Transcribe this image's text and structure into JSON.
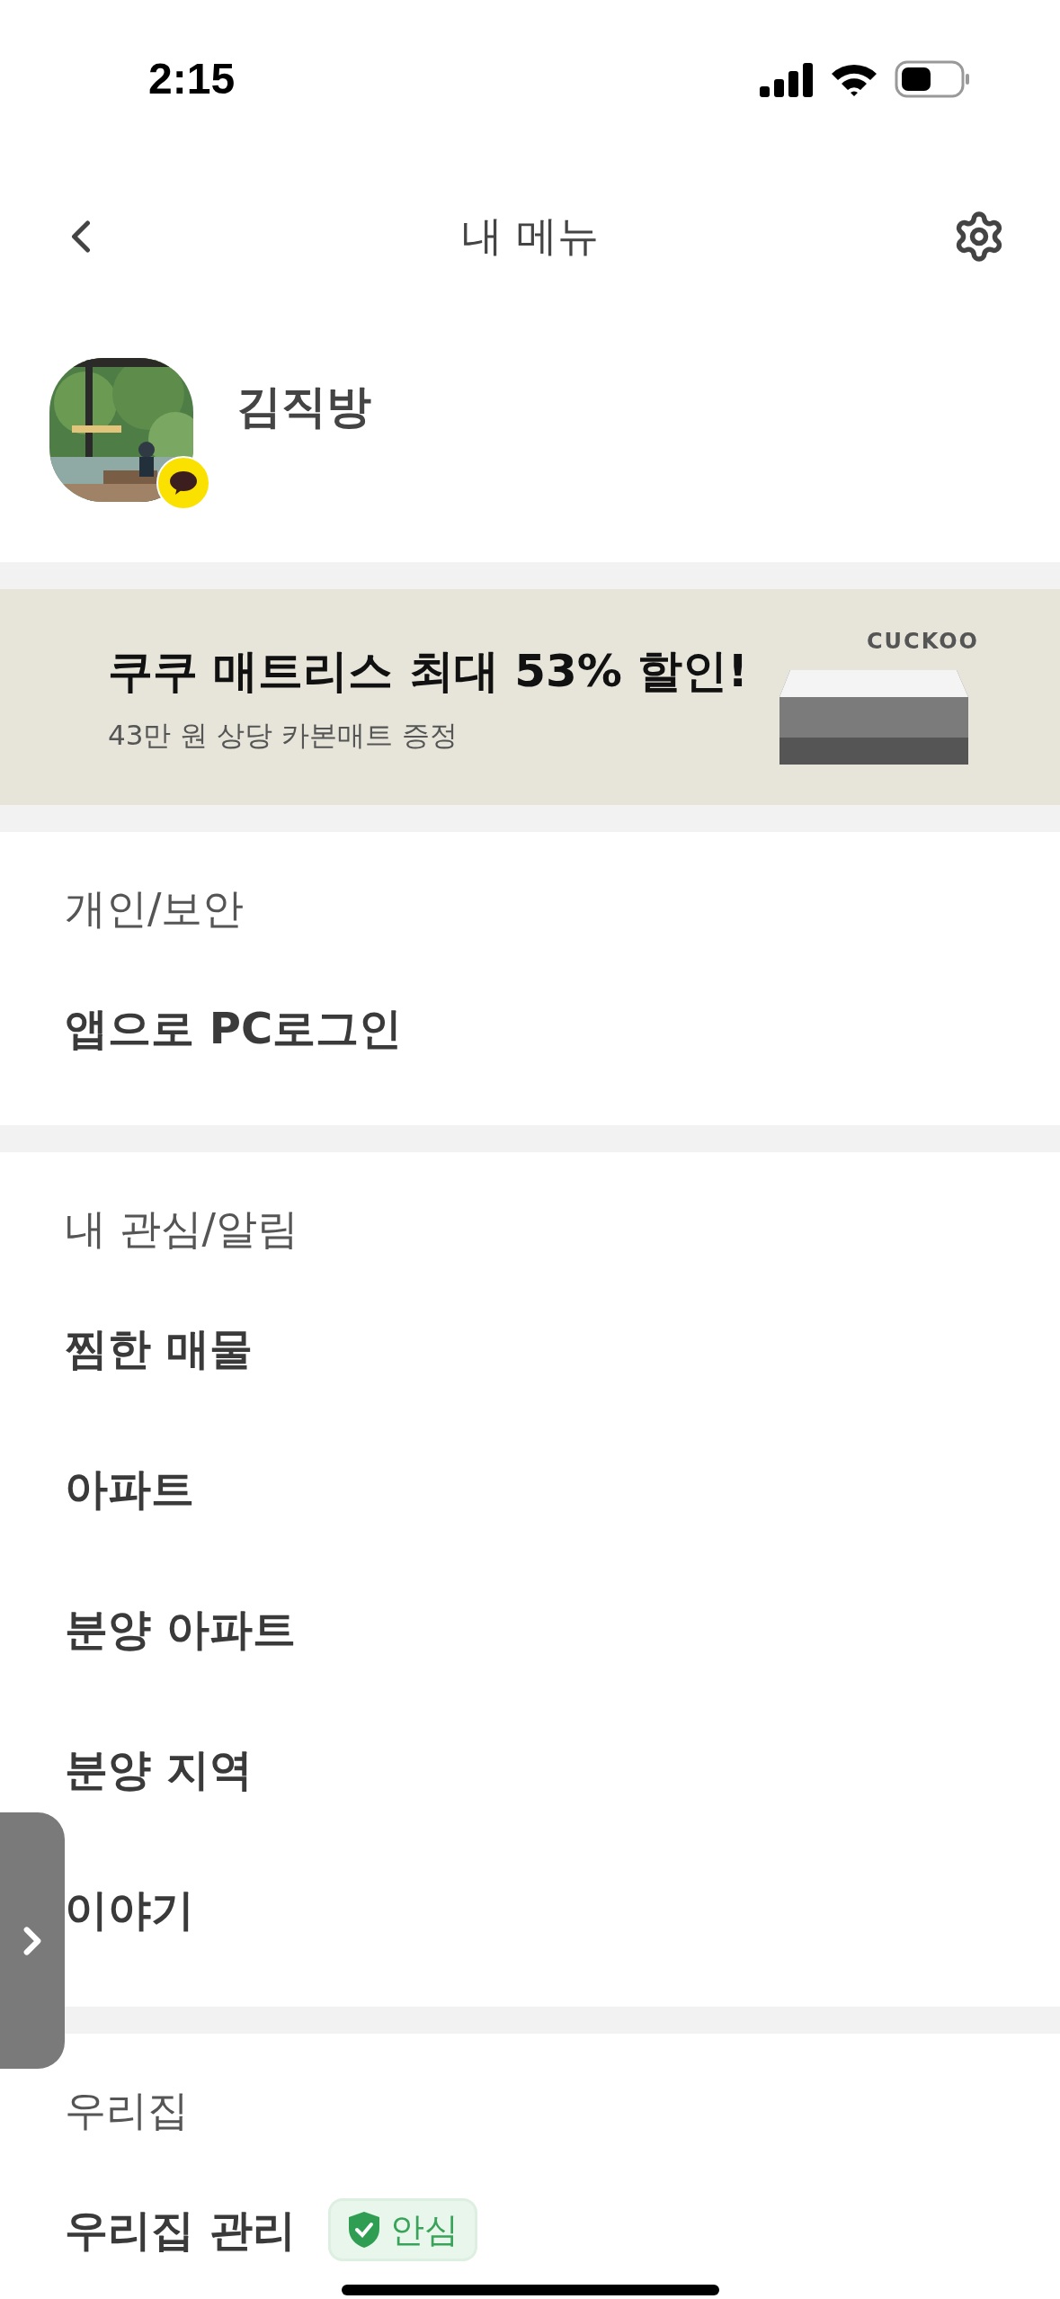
{
  "status_bar": {
    "time": "2:15"
  },
  "header": {
    "title": "내 메뉴"
  },
  "profile": {
    "name": "김직방"
  },
  "banner": {
    "brand": "CUCKOO",
    "headline": "쿠쿠 매트리스 최대 53% 할인!",
    "subtext": "43만 원 상당 카본매트 증정"
  },
  "sections": [
    {
      "title": "개인/보안",
      "items": [
        {
          "label": "앱으로 PC로그인"
        }
      ]
    },
    {
      "title": "내 관심/알림",
      "items": [
        {
          "label": "찜한 매물"
        },
        {
          "label": "아파트"
        },
        {
          "label": "분양 아파트"
        },
        {
          "label": "분양 지역"
        },
        {
          "label": "이야기"
        }
      ]
    },
    {
      "title": "우리집",
      "items": [
        {
          "label": "우리집 관리",
          "badge": "안심"
        }
      ]
    }
  ]
}
